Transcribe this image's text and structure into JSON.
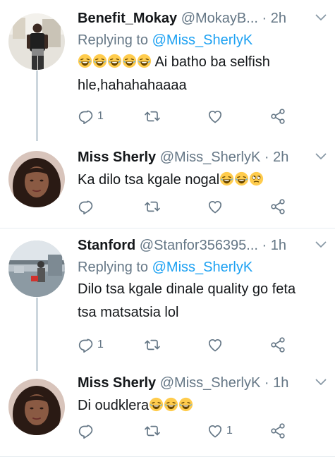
{
  "tweets": [
    {
      "name": "Benefit_Mokay",
      "handle": "@MokayB...",
      "dot": "·",
      "time": "2h",
      "replying_label": "Replying to",
      "replying_handle": "@Miss_SherlyK",
      "emoji_prefix_count": 5,
      "text": "Ai batho ba selfish hle,hahahahaaaa",
      "emoji_suffix_count": 0,
      "emoji_suffix_type": "",
      "reply_count": "1",
      "like_count": ""
    },
    {
      "name": "Miss Sherly",
      "handle": "@Miss_SherlyK",
      "dot": "·",
      "time": "2h",
      "replying_label": "",
      "replying_handle": "",
      "text": "Ka dilo tsa kgale nogal",
      "reply_count": "",
      "like_count": ""
    },
    {
      "name": "Stanford",
      "handle": "@Stanfor356395...",
      "dot": "·",
      "time": "1h",
      "replying_label": "Replying to",
      "replying_handle": "@Miss_SherlyK",
      "text": "Dilo tsa kgale dinale quality go feta tsa matsatsia lol",
      "reply_count": "1",
      "like_count": ""
    },
    {
      "name": "Miss Sherly",
      "handle": "@Miss_SherlyK",
      "dot": "·",
      "time": "1h",
      "replying_label": "",
      "replying_handle": "",
      "text": "Di oudklera",
      "reply_count": "",
      "like_count": "1"
    }
  ],
  "icons": {
    "reply": "reply-icon",
    "retweet": "retweet-icon",
    "like": "heart-icon",
    "share": "share-icon",
    "caret": "chevron-down-icon",
    "laugh": "rolling-on-floor-laughing-emoji",
    "eyeroll": "face-with-rolling-eyes-emoji"
  },
  "colors": {
    "text": "#14171a",
    "secondary": "#657786",
    "link": "#1da1f2",
    "thread_line": "#ccd6dd",
    "divider": "#e6ecf0",
    "emoji_face": "#ffcc4d"
  }
}
